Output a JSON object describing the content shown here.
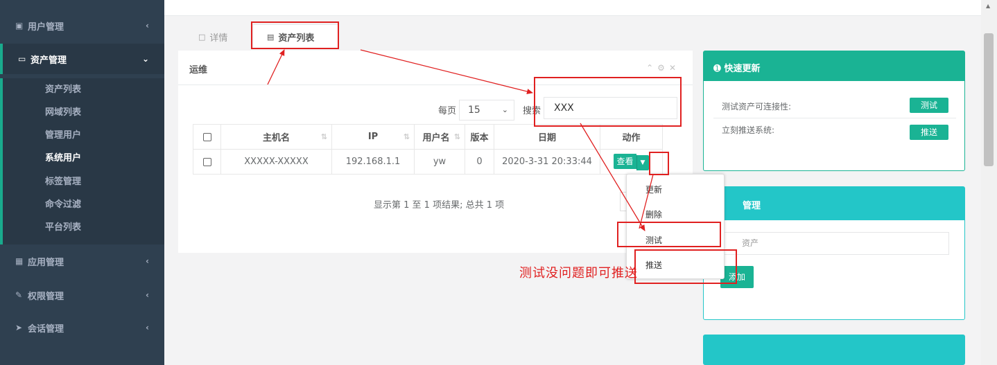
{
  "sidebar": {
    "items": [
      {
        "label": "用户管理",
        "icon": "users-icon"
      },
      {
        "label": "资产管理",
        "icon": "inbox-icon",
        "expanded": true
      },
      {
        "label": "应用管理",
        "icon": "grid-icon"
      },
      {
        "label": "权限管理",
        "icon": "edit-icon"
      },
      {
        "label": "会话管理",
        "icon": "rocket-icon"
      }
    ],
    "submenu": [
      "资产列表",
      "网域列表",
      "管理用户",
      "系统用户",
      "标签管理",
      "命令过滤",
      "平台列表"
    ],
    "active_sub": "系统用户"
  },
  "tabs": [
    {
      "label": "详情",
      "icon": "laptop-icon"
    },
    {
      "label": "资产列表",
      "icon": "bar-chart-icon",
      "active": true
    }
  ],
  "panel": {
    "title": "运维",
    "per_page_label": "每页",
    "per_page_value": "15",
    "search_label": "搜索",
    "search_value": "XXX",
    "columns": [
      "主机名",
      "IP",
      "用户名",
      "版本",
      "日期",
      "动作"
    ],
    "rows": [
      {
        "hostname": "XXXXX-XXXXX",
        "ip": "192.168.1.1",
        "username": "yw",
        "version": "0",
        "date": "2020-3-31 20:33:44",
        "action": "查看"
      }
    ],
    "page_info": "显示第 1 至 1 项结果; 总共 1 项"
  },
  "dropdown": [
    "更新",
    "删除",
    "测试",
    "推送"
  ],
  "quick_update": {
    "title": "快速更新",
    "rows": [
      {
        "label": "测试资产可连接性:",
        "button": "测试"
      },
      {
        "label": "立刻推送系统:",
        "button": "推送"
      }
    ]
  },
  "card2": {
    "title": "管理",
    "input_text": "资产",
    "button": "添加"
  },
  "annotation": "测试没问题即可推送",
  "colors": {
    "sidebar_bg": "#2f4050",
    "accent": "#1ab394",
    "teal": "#23c6c8",
    "annotation_red": "#e02020"
  }
}
